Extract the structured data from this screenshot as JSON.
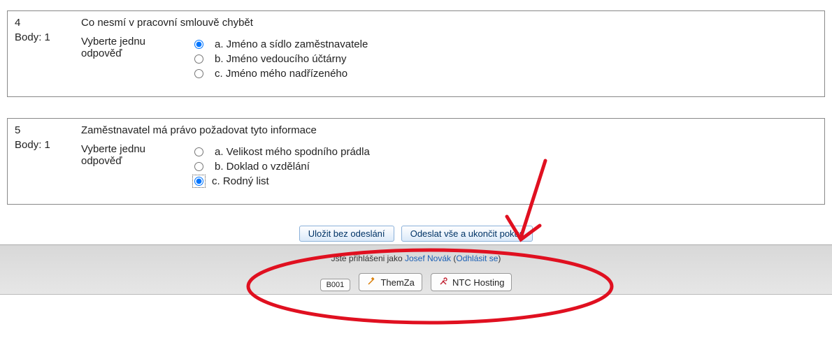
{
  "questions": [
    {
      "number": "4",
      "points_label": "Body: 1",
      "title": "Co nesmí v pracovní smlouvě chybět",
      "prompt": "Vyberte jednu odpověď",
      "answers": [
        {
          "label": "a. Jméno a sídlo zaměstnavatele",
          "checked": true,
          "highlighted": false
        },
        {
          "label": "b. Jméno vedoucího účtárny",
          "checked": false,
          "highlighted": false
        },
        {
          "label": "c. Jméno mého nadřízeného",
          "checked": false,
          "highlighted": false
        }
      ]
    },
    {
      "number": "5",
      "points_label": "Body: 1",
      "title": "Zaměstnavatel má právo požadovat tyto informace",
      "prompt": "Vyberte jednu odpověď",
      "answers": [
        {
          "label": "a. Velikost mého spodního prádla",
          "checked": false,
          "highlighted": false
        },
        {
          "label": "b. Doklad o vzdělání",
          "checked": false,
          "highlighted": false
        },
        {
          "label": "c. Rodný list",
          "checked": true,
          "highlighted": true
        }
      ]
    }
  ],
  "buttons": {
    "save": "Uložit bez odeslání",
    "submit": "Odeslat vše a ukončit pokus"
  },
  "login": {
    "prefix": "Jste přihlášeni jako ",
    "user": "Josef Novák",
    "logout_open": " (",
    "logout": "Odhlásit se",
    "logout_close": ")"
  },
  "footer": {
    "course_code": "B001",
    "themza": "ThemZa",
    "ntc": "NTC Hosting"
  },
  "colors": {
    "annotation": "#e01020"
  }
}
